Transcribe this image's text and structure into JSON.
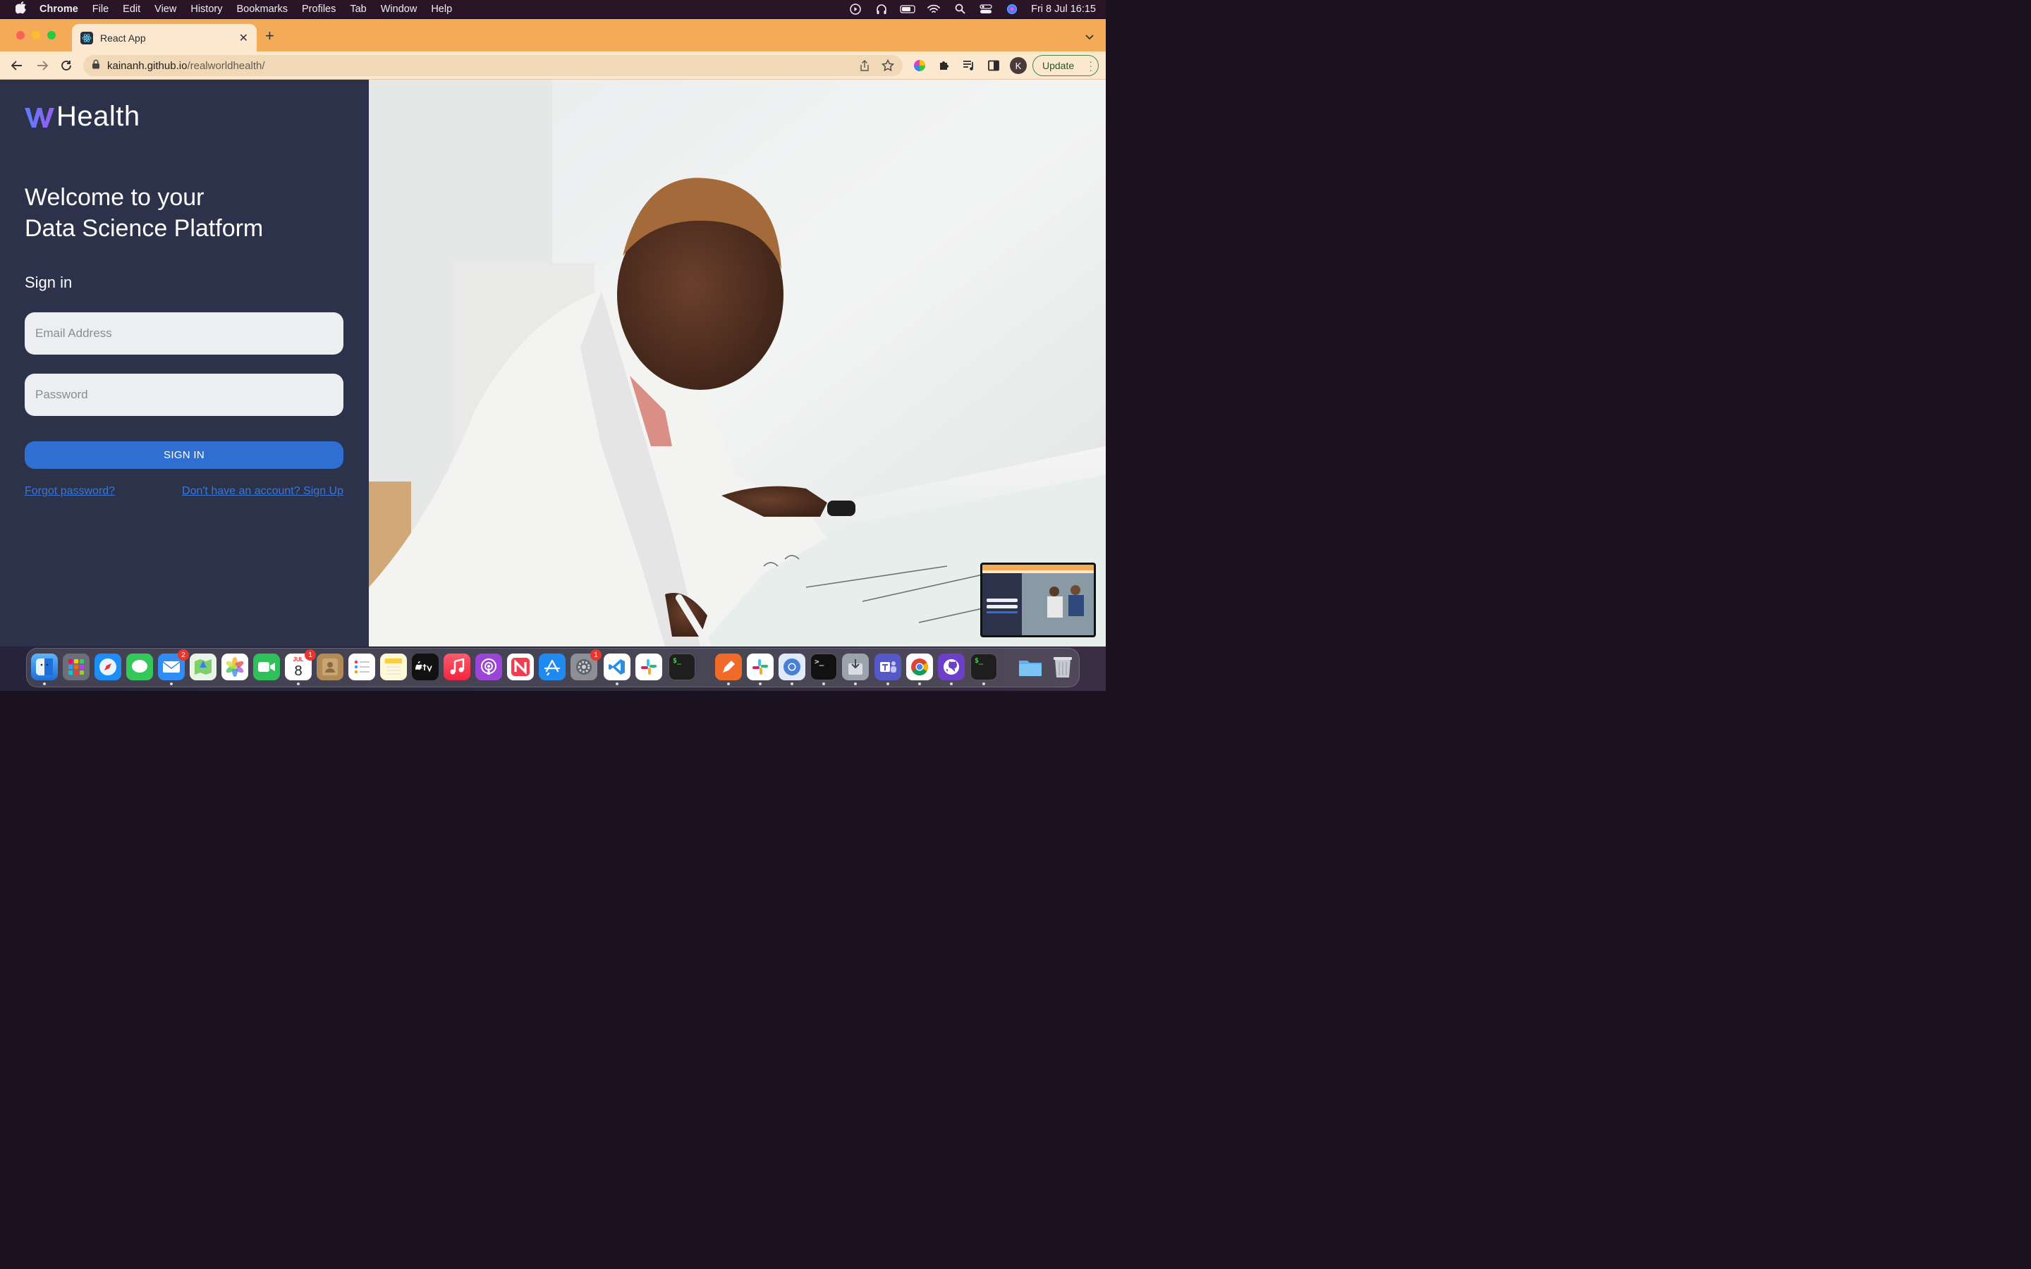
{
  "menubar": {
    "app": "Chrome",
    "items": [
      "File",
      "Edit",
      "View",
      "History",
      "Bookmarks",
      "Profiles",
      "Tab",
      "Window",
      "Help"
    ],
    "clock": "Fri 8 Jul  16:15"
  },
  "browser": {
    "tab_title": "React App",
    "url_host": "kainanh.github.io",
    "url_path": "/realworldhealth/",
    "profile_initial": "K",
    "update_label": "Update"
  },
  "app": {
    "logo_text": "Health",
    "welcome_line1": "Welcome to your",
    "welcome_line2": "Data Science Platform",
    "signin_heading": "Sign in",
    "email_placeholder": "Email Address",
    "password_placeholder": "Password",
    "signin_button": "SIGN IN",
    "forgot_link": "Forgot password?",
    "signup_link": "Don't have an account? Sign Up"
  },
  "dock": {
    "calendar_month": "JUL",
    "calendar_day": "8",
    "mail_badge": "2",
    "calendar_badge": "1",
    "settings_badge": "1"
  },
  "colors": {
    "sidebar_bg": "#2c3249",
    "button_blue": "#2f6fd2",
    "link_blue": "#3a77d6",
    "tabstrip_orange": "#f4ab57"
  }
}
